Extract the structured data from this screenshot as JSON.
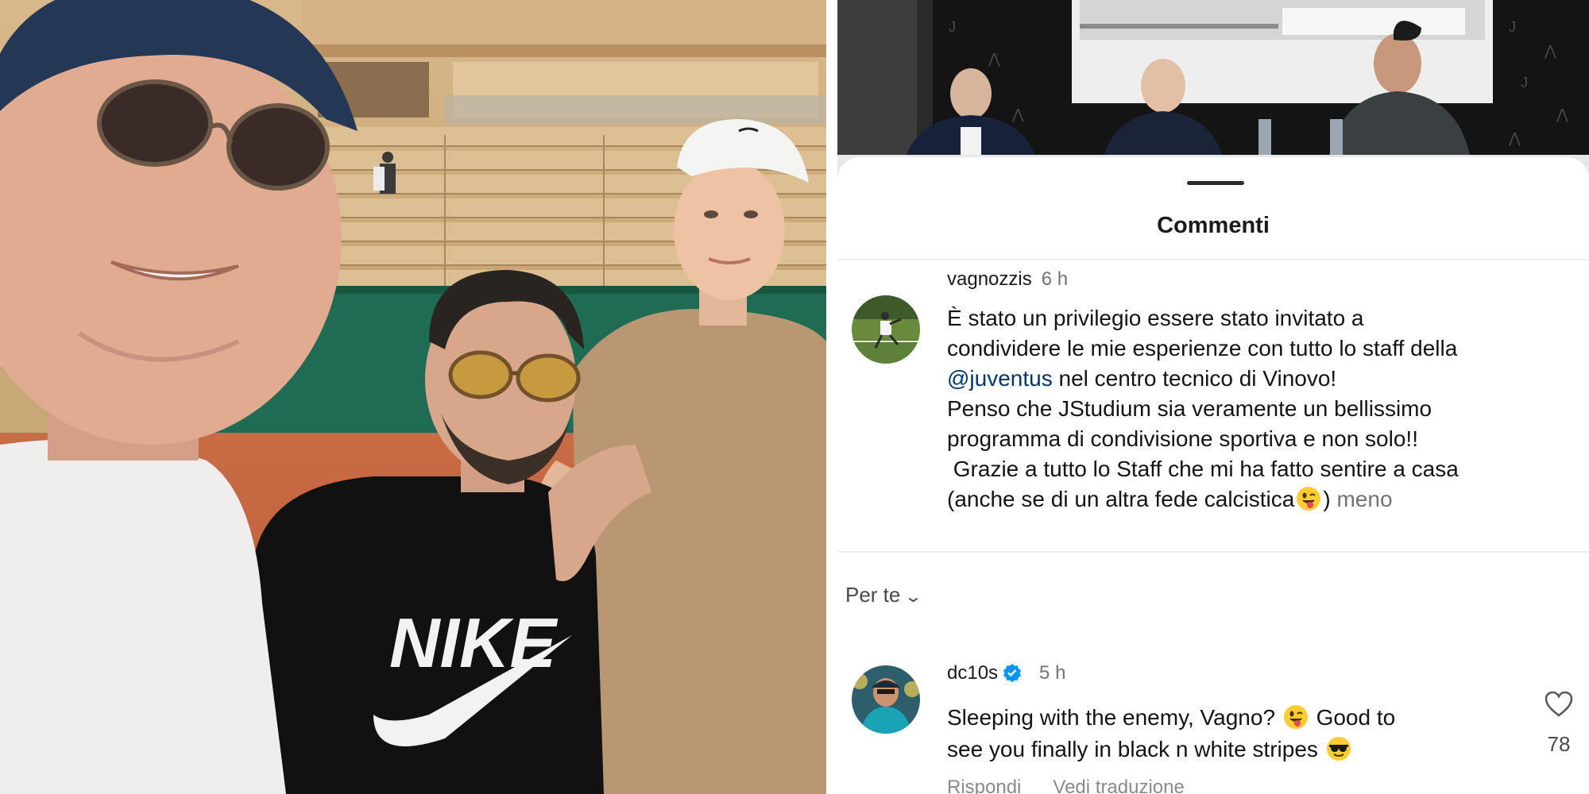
{
  "comments_sheet": {
    "title": "Commenti"
  },
  "post": {
    "username": "vagnozzis",
    "time": "6 h",
    "caption_lines": [
      "È stato un privilegio essere stato invitato a",
      "condividere le mie esperienze con tutto lo staff della",
      "@juventus",
      " nel centro tecnico di Vinovo!",
      "Penso che JStudium sia veramente un bellissimo",
      "programma di condivisione sportiva e non solo!!",
      " Grazie a tutto lo Staff che mi ha fatto sentire a casa",
      "(anche se di un altra fede calcistica",
      ")",
      "meno"
    ],
    "caption_emoji": "winking-tongue-emoji"
  },
  "filter": {
    "label": "Per te",
    "icon": "chevron-down-icon"
  },
  "reply": {
    "username": "dc10s",
    "verified": true,
    "time": "5 h",
    "text_parts": [
      "Sleeping with the enemy, Vagno?",
      " Good to",
      "see you finally in black n white stripes"
    ],
    "emojis": [
      "winking-tongue-emoji",
      "sunglasses-emoji"
    ],
    "like_count": "78",
    "actions": [
      "Rispondi",
      "Vedi traduzione"
    ]
  },
  "colors": {
    "mention": "#00376b",
    "muted_text": "#737373",
    "verified_blue": "#0095f6",
    "shirt_nike": "#111111",
    "court_clay": "#c7653a",
    "court_wall": "#1f6b53"
  }
}
